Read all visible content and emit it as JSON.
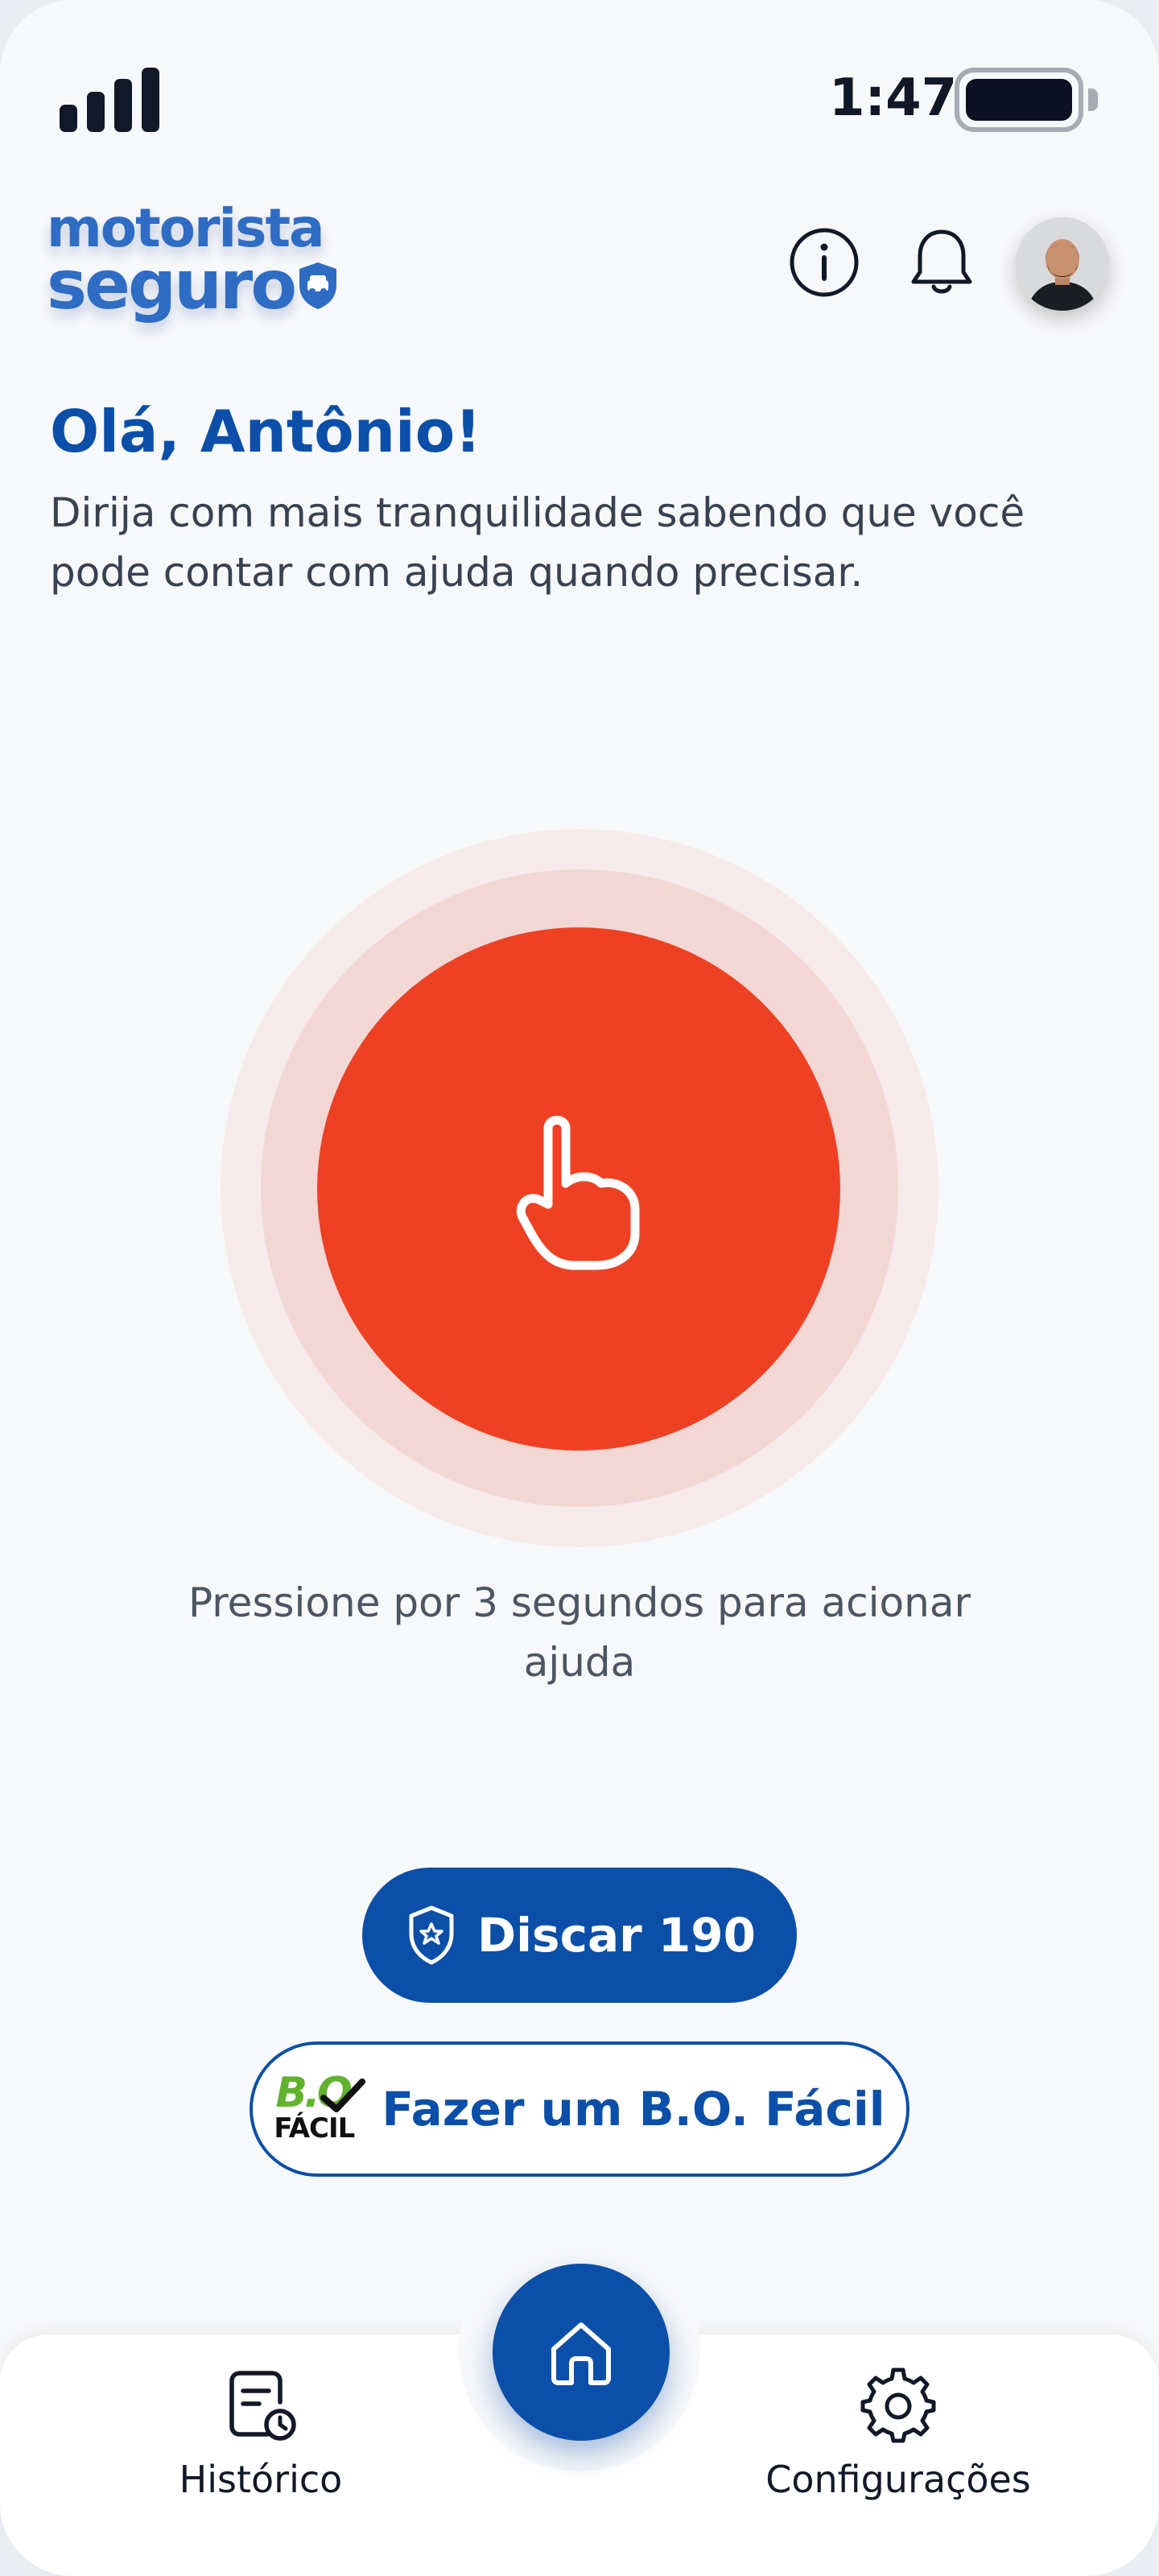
{
  "status_bar": {
    "time": "1:47"
  },
  "header": {
    "logo": {
      "line1": "motorista",
      "line2": "seguro"
    },
    "info_icon": "info-icon",
    "notification_icon": "bell-icon",
    "avatar_alt": "user-avatar"
  },
  "greeting": {
    "title": "Olá, Antônio!",
    "subtitle": "Dirija com mais tranquilidade sabendo que você pode contar com ajuda quando precisar."
  },
  "panic": {
    "icon": "pointing-hand-icon",
    "hint": "Pressione por 3 segundos para acionar ajuda"
  },
  "actions": {
    "dial_label": "Discar 190",
    "bo_logo_top": "B.O",
    "bo_logo_bottom": "FÁCIL",
    "bo_label": "Fazer um B.O. Fácil"
  },
  "bottom_nav": {
    "history_label": "Histórico",
    "settings_label": "Configurações",
    "home_icon": "home-icon"
  },
  "colors": {
    "brand_blue": "#0b4fa8",
    "logo_blue": "#2f6cc4",
    "panic_red": "#ee4124",
    "ring_mid": "#f3d7d5",
    "ring_outer": "#f6eaea",
    "bo_green": "#62b22f",
    "background": "#f7f8fa"
  }
}
